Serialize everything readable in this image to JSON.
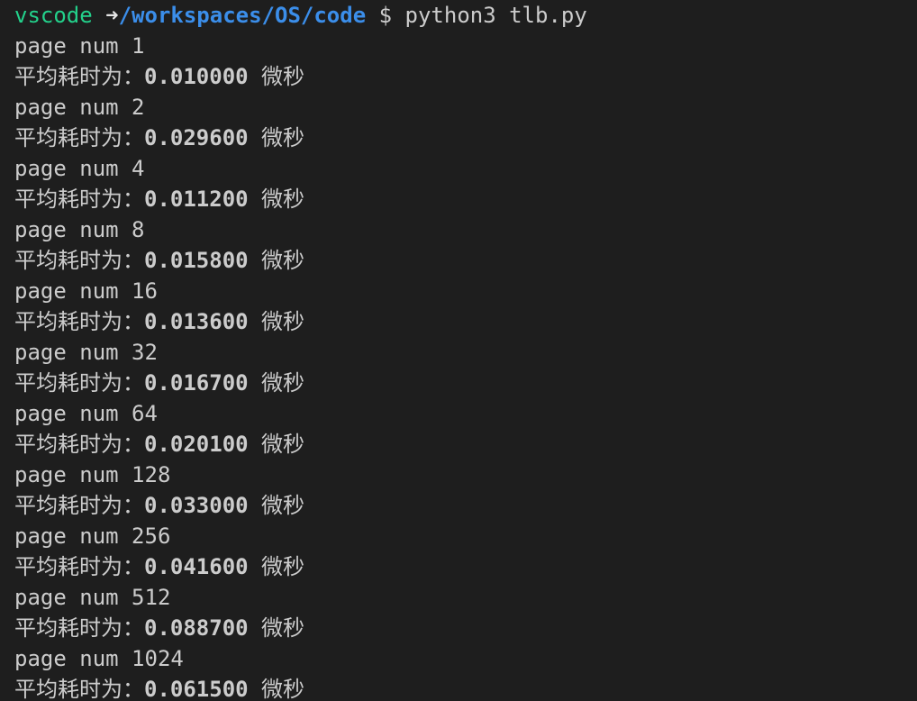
{
  "prompt": {
    "user": "vscode",
    "arrow": "➜",
    "path": "/workspaces/OS/code",
    "symbol": "$",
    "command": "python3 tlb.py"
  },
  "colors": {
    "background": "#1e1e1e",
    "text": "#cccccc",
    "prompt_user": "#23d18b",
    "prompt_path": "#3b8eea"
  },
  "output": [
    {
      "page_line": "page num 1",
      "label": "平均耗时为：",
      "value": "0.010000",
      "unit": "微秒"
    },
    {
      "page_line": "page num 2",
      "label": "平均耗时为：",
      "value": "0.029600",
      "unit": "微秒"
    },
    {
      "page_line": "page num 4",
      "label": "平均耗时为：",
      "value": "0.011200",
      "unit": "微秒"
    },
    {
      "page_line": "page num 8",
      "label": "平均耗时为：",
      "value": "0.015800",
      "unit": "微秒"
    },
    {
      "page_line": "page num 16",
      "label": "平均耗时为：",
      "value": "0.013600",
      "unit": "微秒"
    },
    {
      "page_line": "page num 32",
      "label": "平均耗时为：",
      "value": "0.016700",
      "unit": "微秒"
    },
    {
      "page_line": "page num 64",
      "label": "平均耗时为：",
      "value": "0.020100",
      "unit": "微秒"
    },
    {
      "page_line": "page num 128",
      "label": "平均耗时为：",
      "value": "0.033000",
      "unit": "微秒"
    },
    {
      "page_line": "page num 256",
      "label": "平均耗时为：",
      "value": "0.041600",
      "unit": "微秒"
    },
    {
      "page_line": "page num 512",
      "label": "平均耗时为：",
      "value": "0.088700",
      "unit": "微秒"
    },
    {
      "page_line": "page num 1024",
      "label": "平均耗时为：",
      "value": "0.061500",
      "unit": "微秒"
    }
  ]
}
